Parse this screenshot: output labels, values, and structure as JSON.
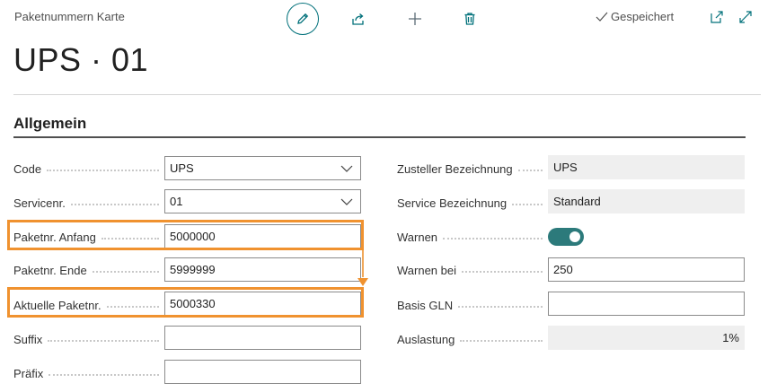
{
  "header": {
    "breadcrumb": "Paketnummern Karte",
    "saved_label": "Gespeichert",
    "title": "UPS · 01"
  },
  "toolbar": {
    "icons": [
      "edit-icon",
      "share-icon",
      "add-icon",
      "delete-icon",
      "open-in-new-window-icon",
      "expand-icon"
    ]
  },
  "section": {
    "title": "Allgemein"
  },
  "left_fields": [
    {
      "label": "Code",
      "value": "UPS"
    },
    {
      "label": "Servicenr.",
      "value": "01"
    },
    {
      "label": "Paketnr. Anfang",
      "value": "5000000"
    },
    {
      "label": "Paketnr. Ende",
      "value": "5999999"
    },
    {
      "label": "Aktuelle Paketnr.",
      "value": "5000330"
    },
    {
      "label": "Suffix",
      "value": ""
    },
    {
      "label": "Präfix",
      "value": ""
    }
  ],
  "right_fields": [
    {
      "label": "Zusteller Bezeichnung",
      "value": "UPS"
    },
    {
      "label": "Service Bezeichnung",
      "value": "Standard"
    },
    {
      "label": "Warnen",
      "value": "on"
    },
    {
      "label": "Warnen bei",
      "value": "250"
    },
    {
      "label": "Basis GLN",
      "value": ""
    },
    {
      "label": "Auslastung",
      "value": "1%"
    }
  ],
  "colors": {
    "accent": "#00707a",
    "highlight": "#f0922f",
    "toggle_on": "#2c7a7b"
  }
}
